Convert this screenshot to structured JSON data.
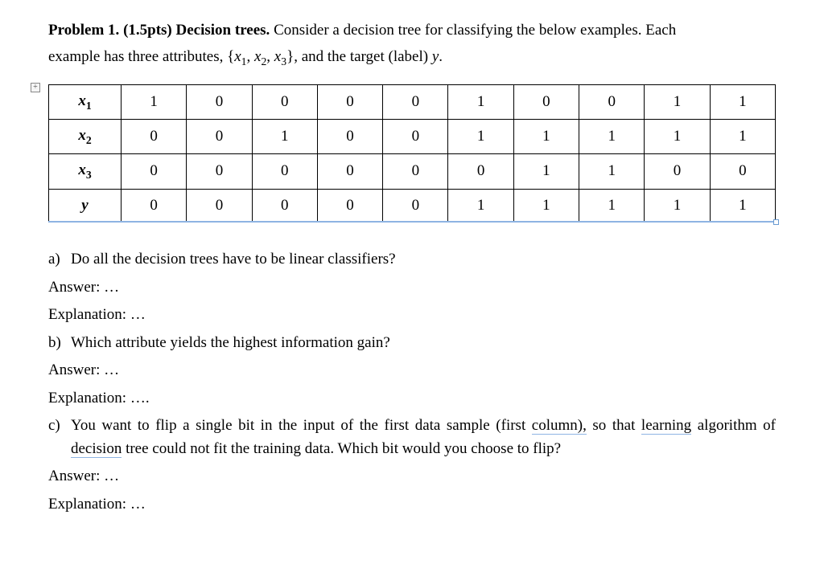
{
  "problem": {
    "number": "Problem 1.",
    "points": "(1.5pts)",
    "title": "Decision trees.",
    "intro_part1": "Consider a decision tree for classifying the below examples. Each",
    "intro_part2_pre": "example has three attributes, {",
    "intro_vars": "x",
    "intro_sub1": "1",
    "intro_comma1": ", ",
    "intro_sub2": "2",
    "intro_comma2": ", ",
    "intro_sub3": "3",
    "intro_part2_post": "}, and the target (label) ",
    "intro_y": "y",
    "intro_period": "."
  },
  "expand_icon": "+",
  "table": {
    "rows": [
      {
        "label": "x",
        "sub": "1",
        "values": [
          "1",
          "0",
          "0",
          "0",
          "0",
          "1",
          "0",
          "0",
          "1",
          "1"
        ]
      },
      {
        "label": "x",
        "sub": "2",
        "values": [
          "0",
          "0",
          "1",
          "0",
          "0",
          "1",
          "1",
          "1",
          "1",
          "1"
        ]
      },
      {
        "label": "x",
        "sub": "3",
        "values": [
          "0",
          "0",
          "0",
          "0",
          "0",
          "0",
          "1",
          "1",
          "0",
          "0"
        ]
      },
      {
        "label": "y",
        "sub": "",
        "values": [
          "0",
          "0",
          "0",
          "0",
          "0",
          "1",
          "1",
          "1",
          "1",
          "1"
        ]
      }
    ]
  },
  "questions": {
    "a": {
      "letter": "a)",
      "text": "Do all the decision trees have to be linear classifiers?",
      "answer_label": "Answer: …",
      "explanation_label": "Explanation: …"
    },
    "b": {
      "letter": "b)",
      "text": "Which attribute yields the highest information gain?",
      "answer_label": "Answer: …",
      "explanation_label": "Explanation: …."
    },
    "c": {
      "letter": "c)",
      "pre": "You want to flip a single bit in the input of the first data sample (first ",
      "under1": "column),",
      "mid1": " so that ",
      "under2": "learning",
      "line2_pre": "algorithm of ",
      "under3": "decision",
      "line2_post": " tree could not fit the training data. Which bit would you choose to flip?",
      "answer_label": "Answer: …",
      "explanation_label": "Explanation: …"
    }
  }
}
